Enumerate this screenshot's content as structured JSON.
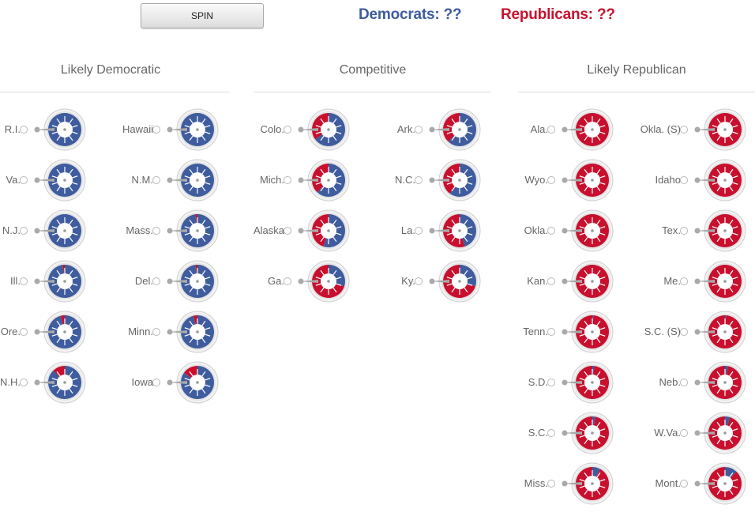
{
  "controls": {
    "spin_label": "SPIN"
  },
  "scores": {
    "democrats": "Democrats: ??",
    "republicans": "Republicans: ??",
    "dem_color": "#3e5c9e",
    "rep_color": "#c8102e"
  },
  "columns": [
    {
      "title": "Likely Democratic",
      "races": [
        {
          "state": "R.I.",
          "dem_share": 1.0
        },
        {
          "state": "Hawaii",
          "dem_share": 1.0
        },
        {
          "state": "Va.",
          "dem_share": 1.0
        },
        {
          "state": "N.M.",
          "dem_share": 1.0
        },
        {
          "state": "N.J.",
          "dem_share": 1.0
        },
        {
          "state": "Mass.",
          "dem_share": 0.98
        },
        {
          "state": "Ill.",
          "dem_share": 0.98
        },
        {
          "state": "Del.",
          "dem_share": 0.98
        },
        {
          "state": "Ore.",
          "dem_share": 0.96
        },
        {
          "state": "Minn.",
          "dem_share": 0.96
        },
        {
          "state": "N.H.",
          "dem_share": 0.88
        },
        {
          "state": "Iowa",
          "dem_share": 0.85
        }
      ]
    },
    {
      "title": "Competitive",
      "races": [
        {
          "state": "Colo.",
          "dem_share": 0.65
        },
        {
          "state": "Ark.",
          "dem_share": 0.62
        },
        {
          "state": "Mich.",
          "dem_share": 0.62
        },
        {
          "state": "N.C.",
          "dem_share": 0.6
        },
        {
          "state": "Alaska",
          "dem_share": 0.55
        },
        {
          "state": "La.",
          "dem_share": 0.45
        },
        {
          "state": "Ga.",
          "dem_share": 0.3
        },
        {
          "state": "Ky.",
          "dem_share": 0.3
        }
      ]
    },
    {
      "title": "Likely Republican",
      "races": [
        {
          "state": "Ala.",
          "dem_share": 0.0
        },
        {
          "state": "Okla. (S)",
          "dem_share": 0.0
        },
        {
          "state": "Wyo.",
          "dem_share": 0.0
        },
        {
          "state": "Idaho",
          "dem_share": 0.0
        },
        {
          "state": "Okla.",
          "dem_share": 0.0
        },
        {
          "state": "Tex.",
          "dem_share": 0.0
        },
        {
          "state": "Kan.",
          "dem_share": 0.0
        },
        {
          "state": "Me.",
          "dem_share": 0.0
        },
        {
          "state": "Tenn.",
          "dem_share": 0.01
        },
        {
          "state": "S.C. (S)",
          "dem_share": 0.01
        },
        {
          "state": "S.D.",
          "dem_share": 0.02
        },
        {
          "state": "Neb.",
          "dem_share": 0.03
        },
        {
          "state": "S.C.",
          "dem_share": 0.03
        },
        {
          "state": "W.Va.",
          "dem_share": 0.05
        },
        {
          "state": "Miss.",
          "dem_share": 0.08
        },
        {
          "state": "Mont.",
          "dem_share": 0.12
        }
      ]
    }
  ]
}
